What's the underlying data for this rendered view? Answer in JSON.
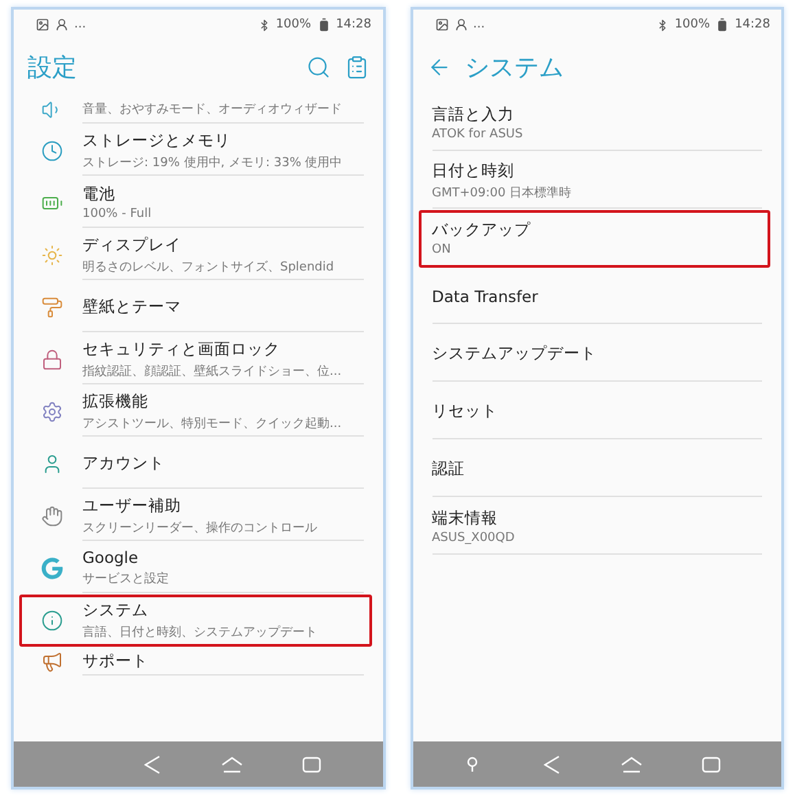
{
  "left": {
    "status_bar": {
      "more": "...",
      "battery": "100%",
      "time": "14:28"
    },
    "title": "設定",
    "items": [
      {
        "subtitle": "音量、おやすみモード、オーディオウィザード",
        "highlighted": false
      },
      {
        "title": "ストレージとメモリ",
        "subtitle": "ストレージ: 19% 使用中, メモリ: 33% 使用中",
        "highlighted": false
      },
      {
        "title": "電池",
        "subtitle": "100% - Full",
        "highlighted": false
      },
      {
        "title": "ディスプレイ",
        "subtitle": "明るさのレベル、フォントサイズ、Splendid",
        "highlighted": false
      },
      {
        "title": "壁紙とテーマ",
        "highlighted": false
      },
      {
        "title": "セキュリティと画面ロック",
        "subtitle": "指紋認証、顔認証、壁紙スライドショー、位...",
        "highlighted": false
      },
      {
        "title": "拡張機能",
        "subtitle": "アシストツール、特別モード、クイック起動...",
        "highlighted": false
      },
      {
        "title": "アカウント",
        "highlighted": false
      },
      {
        "title": "ユーザー補助",
        "subtitle": "スクリーンリーダー、操作のコントロール",
        "highlighted": false
      },
      {
        "title": "Google",
        "subtitle": "サービスと設定",
        "highlighted": false
      },
      {
        "title": "システム",
        "subtitle": "言語、日付と時刻、システムアップデート",
        "highlighted": true
      },
      {
        "title": "サポート",
        "highlighted": false
      }
    ]
  },
  "right": {
    "status_bar": {
      "more": "...",
      "battery": "100%",
      "time": "14:28"
    },
    "title": "システム",
    "items": [
      {
        "title": "言語と入力",
        "subtitle": "ATOK for ASUS",
        "highlighted": false
      },
      {
        "title": "日付と時刻",
        "subtitle": "GMT+09:00 日本標準時",
        "highlighted": false
      },
      {
        "title": "バックアップ",
        "subtitle": "ON",
        "highlighted": true
      },
      {
        "title": "Data Transfer",
        "highlighted": false
      },
      {
        "title": "システムアップデート",
        "highlighted": false
      },
      {
        "title": "リセット",
        "highlighted": false
      },
      {
        "title": "認証",
        "highlighted": false
      },
      {
        "title": "端末情報",
        "subtitle": "ASUS_X00QD",
        "highlighted": false
      }
    ]
  }
}
